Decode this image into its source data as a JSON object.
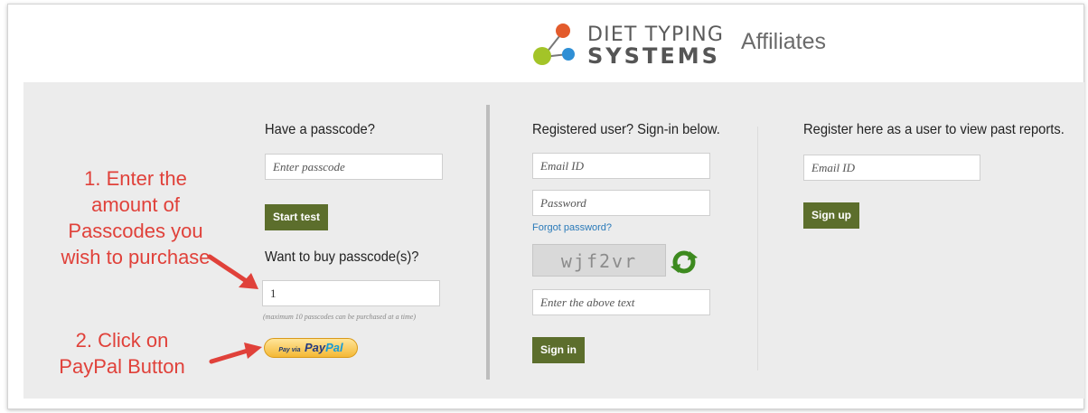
{
  "header": {
    "logo_line1": "DIET TYPING",
    "logo_line2": "SYSTEMS",
    "affiliates": "Affiliates"
  },
  "passcode_section": {
    "heading": "Have a passcode?",
    "input_placeholder": "Enter passcode",
    "start_button": "Start test",
    "buy_heading": "Want to buy passcode(s)?",
    "quantity_value": "1",
    "quantity_note": "(maximum 10 passcodes can be purchased at a time)",
    "paypal_via": "Pay via",
    "paypal_pay": "Pay",
    "paypal_pal": "Pal"
  },
  "signin_section": {
    "heading": "Registered user? Sign-in below.",
    "email_placeholder": "Email ID",
    "password_placeholder": "Password",
    "forgot_link": "Forgot password?",
    "captcha_text": "wjf2vr",
    "captcha_input_placeholder": "Enter the above text",
    "signin_button": "Sign in"
  },
  "register_section": {
    "heading": "Register here as a user to view past reports.",
    "email_placeholder": "Email ID",
    "signup_button": "Sign up"
  },
  "annotations": {
    "step1_lines": [
      "1. Enter the",
      "amount of",
      "Passcodes you",
      "wish to purchase"
    ],
    "step2_lines": [
      "2. Click on",
      "PayPal Button"
    ]
  },
  "colors": {
    "button_green": "#5c6e2c",
    "annotation_red": "#e0413a",
    "link_blue": "#2a7ab9",
    "logo_orange": "#e35b2c",
    "logo_lime": "#a3c428",
    "logo_blue": "#2f8fd5"
  }
}
